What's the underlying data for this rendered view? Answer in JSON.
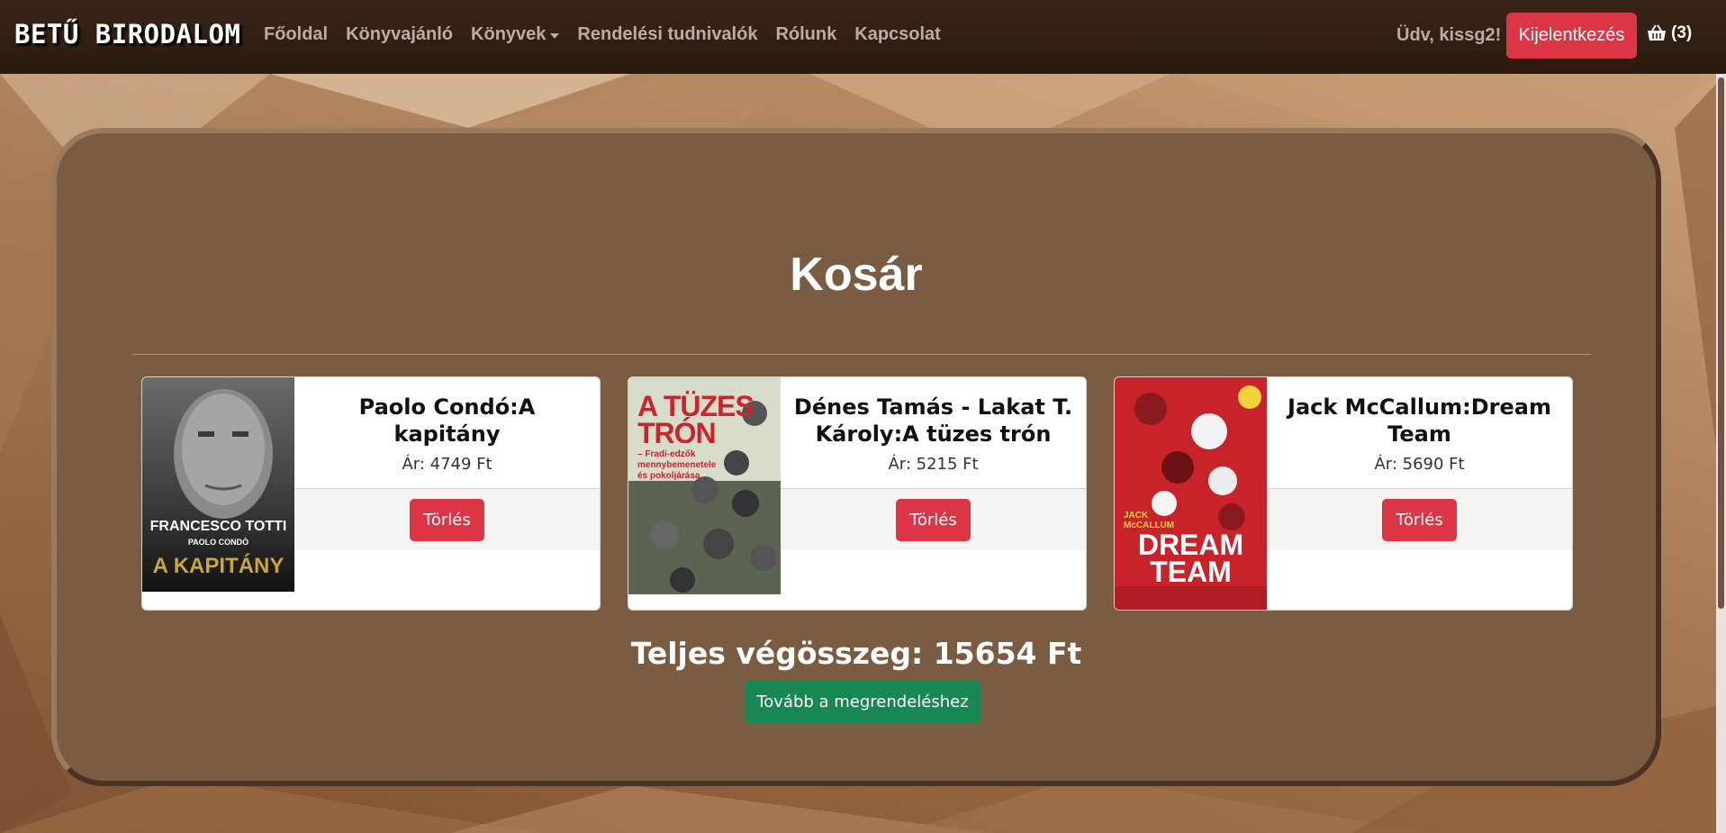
{
  "nav": {
    "brand": "BETŰ BIRODALOM",
    "links": [
      "Főoldal",
      "Könyvajánló",
      "Könyvek",
      "Rendelési tudnivalók",
      "Rólunk",
      "Kapcsolat"
    ],
    "greeting": "Üdv, kissg2!",
    "logout_label": "Kijelentkezés",
    "cart_count": "(3)"
  },
  "cart": {
    "title": "Kosár",
    "items": [
      {
        "title": "Paolo Condó:A kapitány",
        "price": "Ár: 4749 Ft",
        "delete_label": "Törlés",
        "cover": {
          "line1": "FRANCESCO TOTTI",
          "line2": "PAOLO CONDÒ",
          "line3": "A KAPITÁNY"
        }
      },
      {
        "title": "Dénes Tamás - Lakat T. Károly:A tüzes trón",
        "price": "Ár: 5215 Ft",
        "delete_label": "Törlés",
        "cover": {
          "line1": "A TÜZES",
          "line2": "TRÓN",
          "line3": "– Fradi-edzők mennybemenetele és pokoljárása"
        }
      },
      {
        "title": "Jack McCallum:Dream Team",
        "price": "Ár: 5690 Ft",
        "delete_label": "Törlés",
        "cover": {
          "line1": "JACK McCALLUM",
          "line2": "DREAM",
          "line3": "TEAM"
        }
      }
    ],
    "total": "Teljes végösszeg: 15654 Ft",
    "checkout_label": "Tovább a megrendeléshez"
  },
  "colors": {
    "navbar": "#2c1a10",
    "panel": "#7a5c43",
    "danger": "#dc3545",
    "success": "#198754"
  }
}
